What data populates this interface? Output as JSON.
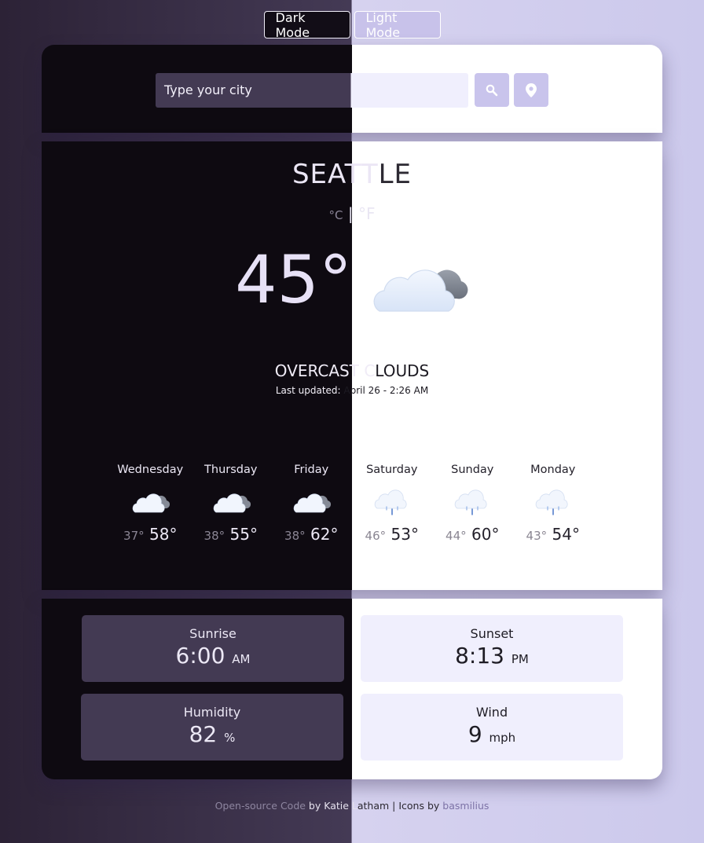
{
  "mode_toggle": {
    "dark_label": "Dark Mode",
    "light_label": "Light Mode"
  },
  "search": {
    "placeholder": "Type your city"
  },
  "weather": {
    "city_left": "SEATT",
    "city_right": "LE",
    "unit_c": "°C",
    "unit_sep": " | ",
    "unit_f": "°F",
    "temperature": "45°",
    "description_left": "OVERCAST C",
    "description_right": "LOUDS",
    "updated_left": "Last updated: ",
    "updated_right": "April 26 - 2:26 AM",
    "icon": "overcast-clouds-icon"
  },
  "forecast": [
    {
      "day": "Wednesday",
      "low": "37°",
      "high": "58°",
      "icon": "cloudy-icon"
    },
    {
      "day": "Thursday",
      "low": "38°",
      "high": "55°",
      "icon": "cloudy-icon"
    },
    {
      "day": "Friday",
      "low": "38°",
      "high": "62°",
      "icon": "cloudy-icon"
    },
    {
      "day": "Saturday",
      "low": "46°",
      "high": "53°",
      "icon": "rain-cloud-icon"
    },
    {
      "day": "Sunday",
      "low": "44°",
      "high": "60°",
      "icon": "rain-cloud-icon"
    },
    {
      "day": "Monday",
      "low": "43°",
      "high": "54°",
      "icon": "rain-cloud-icon"
    }
  ],
  "stats": {
    "sunrise": {
      "label": "Sunrise",
      "value": "6:00",
      "suffix": "AM"
    },
    "sunset": {
      "label": "Sunset",
      "value": "8:13",
      "suffix": "PM"
    },
    "humidity": {
      "label": "Humidity",
      "value": "82",
      "suffix": "%"
    },
    "wind": {
      "label": "Wind",
      "value": "9",
      "suffix": "mph"
    }
  },
  "footer": {
    "code_link": "Open-source Code",
    "by_left": " by Katie L",
    "by_right": "atham | Icons by ",
    "icons_link": "basmilius"
  }
}
